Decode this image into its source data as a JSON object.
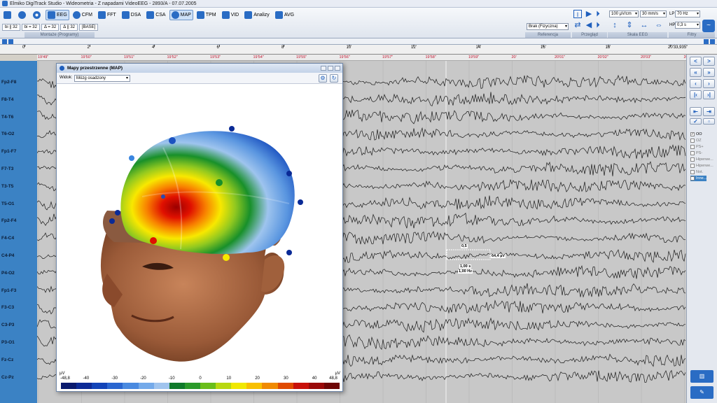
{
  "window": {
    "title": "Elmiko DigiTrack Studio  -  Wideometria  -  Z napadami VideoEEG  -  2893/A  -  07.07.2005"
  },
  "ribbon": {
    "buttons": [
      {
        "label": "",
        "icon": "montage-icon"
      },
      {
        "label": "",
        "icon": "eye-icon"
      },
      {
        "label": "",
        "icon": "gear-icon"
      },
      {
        "label": "EEG",
        "icon": "eeg-icon",
        "active": true
      },
      {
        "label": "CFM",
        "icon": "cfm-icon"
      },
      {
        "label": "FFT",
        "icon": "fft-icon"
      },
      {
        "label": "DSA",
        "icon": "dsa-icon"
      },
      {
        "label": "CSA",
        "icon": "csa-icon"
      },
      {
        "label": "MAP",
        "icon": "map-icon",
        "active": true
      },
      {
        "label": "TPM",
        "icon": "tpm-icon"
      },
      {
        "label": "VID",
        "icon": "video-icon"
      },
      {
        "label": "Analizy",
        "icon": "analysis-icon"
      },
      {
        "label": "AVG",
        "icon": "sigma-icon"
      }
    ],
    "montage_tabs": [
      "bi || 32",
      "bi = 32",
      "Δ = 32",
      "Δ || 32",
      "[BASE]"
    ],
    "group_labels": {
      "montage": "Montaże (Programy)",
      "reference": "Referencja",
      "review": "Przegląd",
      "scale": "Skala EEG",
      "filters": "Filtry"
    },
    "reference_select": "Brak (Fizyczna)",
    "sensitivity_select": "100 µV/cm",
    "speed_select": "30 mm/s",
    "lp_label": "LP",
    "lp_select": "70 Hz",
    "hp_label": "HP",
    "hp_select": "0,3 s"
  },
  "timescale": {
    "ticks": [
      "0'",
      "2'",
      "4'",
      "6'",
      "8'",
      "10'",
      "12'",
      "14'",
      "16'",
      "18'",
      "20'33,935\""
    ],
    "clock": [
      "19'49\"",
      "19'50\"",
      "19'51\"",
      "19'52\"",
      "19'53\"",
      "19'54\"",
      "19'55\"",
      "19'56\"",
      "19'57\"",
      "19'58\"",
      "19'59\"",
      "20'",
      "20'01\"",
      "20'02\"",
      "20'03\"",
      "20'04\""
    ]
  },
  "channels": [
    "Fp2-F8",
    "F8-T4",
    "T4-T6",
    "T6-O2",
    "Fp1-F7",
    "F7-T3",
    "T3-T5",
    "T5-O1",
    "Fp2-F4",
    "F4-C4",
    "C4-P4",
    "P4-O2",
    "Fp1-F3",
    "F3-C3",
    "C3-P3",
    "P3-O1",
    "Fz-Cz",
    "Cz-Pz"
  ],
  "calibration": {
    "time": "0,5",
    "amplitude": "64,4 µV",
    "line1": "1,00 s",
    "line2": "1,00 Hz"
  },
  "sidebar": {
    "checks": [
      {
        "label": "OO",
        "on": true
      },
      {
        "label": "OZ",
        "on": false
      },
      {
        "label": "PS+",
        "on": false
      },
      {
        "label": "PS-",
        "on": false
      },
      {
        "label": "Hiperwe...",
        "on": false
      },
      {
        "label": "Hiperwe...",
        "on": false
      },
      {
        "label": "Not.",
        "on": false
      },
      {
        "label": "Inne...",
        "on": false,
        "selected": true
      }
    ]
  },
  "map_window": {
    "title": "Mapy przestrzenne (MAP)",
    "view_label": "Widok:",
    "view_select": "Mózg osadzony",
    "unit": "µV",
    "scale_values": [
      "-48,8",
      "-40",
      "-30",
      "-20",
      "-10",
      "0",
      "10",
      "20",
      "30",
      "40",
      "48,8"
    ],
    "scale_range": [
      -48.8,
      48.8
    ],
    "colors": [
      "#0a1a6e",
      "#0c2a96",
      "#1244b8",
      "#2a66d0",
      "#4a8ae0",
      "#74aaea",
      "#a0c4ee",
      "#0f7a2a",
      "#2a9a2a",
      "#6abe1a",
      "#b8d810",
      "#f0e800",
      "#f8c000",
      "#f08a00",
      "#e04a00",
      "#c8100a",
      "#9a0a0a",
      "#6e0606"
    ]
  }
}
